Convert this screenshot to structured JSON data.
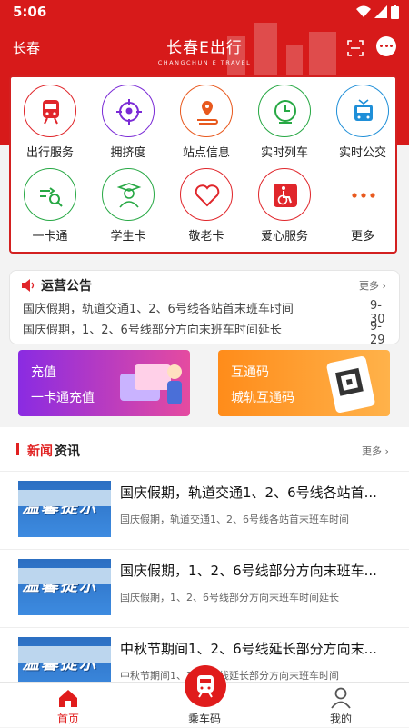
{
  "status_bar": {
    "time": "5:06"
  },
  "header": {
    "city": "长春",
    "brand_title": "长春E出行",
    "brand_sub": "CHANGCHUN E TRAVEL"
  },
  "services": [
    {
      "label": "出行服务",
      "icon": "train-icon",
      "color": "#e0262b"
    },
    {
      "label": "拥挤度",
      "icon": "target-icon",
      "color": "#7a2ad6"
    },
    {
      "label": "站点信息",
      "icon": "location-route-icon",
      "color": "#e8591e"
    },
    {
      "label": "实时列车",
      "icon": "clock-icon",
      "color": "#27a844"
    },
    {
      "label": "实时公交",
      "icon": "tram-icon",
      "color": "#1f8fd8"
    },
    {
      "label": "一卡通",
      "icon": "card-search-icon",
      "color": "#27a844"
    },
    {
      "label": "学生卡",
      "icon": "student-icon",
      "color": "#27a844"
    },
    {
      "label": "敬老卡",
      "icon": "heart-icon",
      "color": "#e0262b"
    },
    {
      "label": "爱心服务",
      "icon": "wheelchair-icon",
      "color": "#e0262b"
    },
    {
      "label": "更多",
      "icon": "more-dots-icon",
      "color": "#e8591e"
    }
  ],
  "notice": {
    "title": "运营公告",
    "more": "更多",
    "items": [
      {
        "text": "国庆假期，轨道交通1、2、6号线各站首末班车时间",
        "date": "9-30"
      },
      {
        "text": "国庆假期，1、2、6号线部分方向末班车时间延长",
        "date": "9-29"
      }
    ]
  },
  "banners": {
    "left": {
      "title": "充值",
      "subtitle": "一卡通充值"
    },
    "right": {
      "title": "互通码",
      "subtitle": "城轨互通码"
    }
  },
  "news": {
    "title_a": "新闻",
    "title_b": "资讯",
    "more": "更多",
    "thumb_text": "温馨提示",
    "items": [
      {
        "title": "国庆假期，轨道交通1、2、6号线各站首...",
        "summary": "国庆假期，轨道交通1、2、6号线各站首末班车时间"
      },
      {
        "title": "国庆假期，1、2、6号线部分方向末班车...",
        "summary": "国庆假期，1、2、6号线部分方向末班车时间延长"
      },
      {
        "title": "中秋节期间1、2、6号线延长部分方向末...",
        "summary": "中秋节期间1、2、6号线延长部分方向末班车时间"
      }
    ]
  },
  "tabbar": {
    "home": "首页",
    "ride": "乘车码",
    "mine": "我的"
  },
  "colors": {
    "brand": "#d71a1a"
  }
}
